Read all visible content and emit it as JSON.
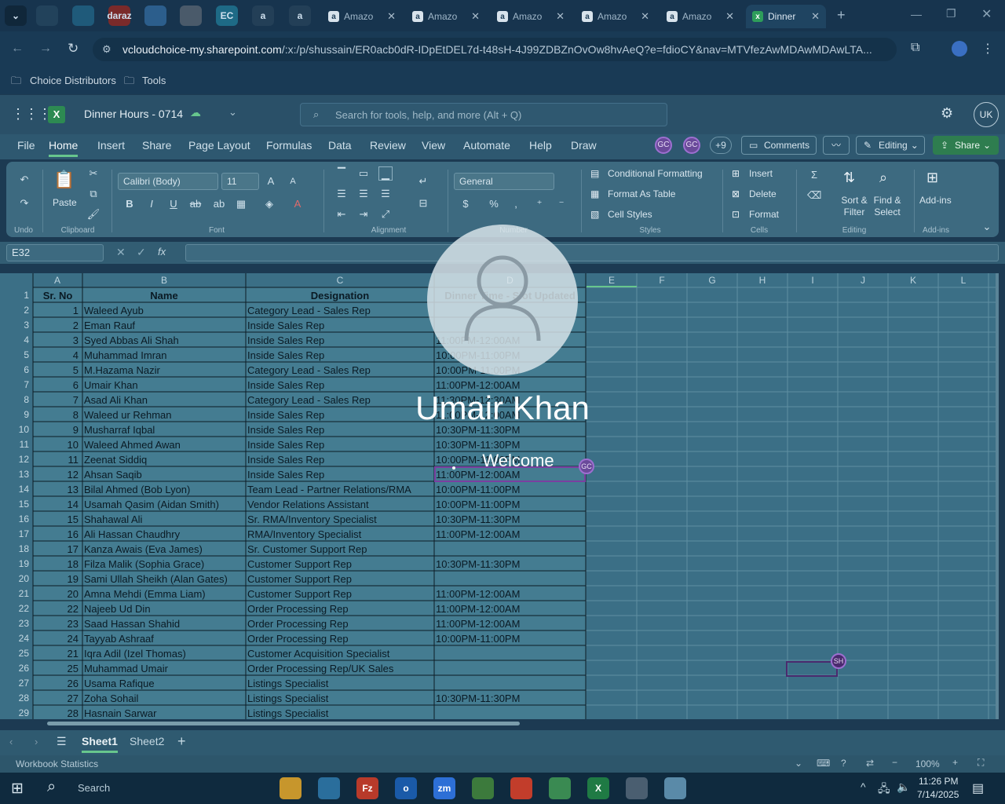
{
  "browser": {
    "pinned_icons": [
      "ring-icon",
      "edge-app-icon",
      "daraz-icon",
      "g-app-icon",
      "puzzle-app-icon",
      "ec-icon",
      "amazon-icon",
      "amazon-icon"
    ],
    "pinned_texts": [
      "",
      "",
      "daraz",
      "",
      "",
      "EC",
      "a",
      "a"
    ],
    "tabs": [
      {
        "label": "Amazo",
        "close": "✕"
      },
      {
        "label": "Amazo",
        "close": "✕"
      },
      {
        "label": "Amazo",
        "close": "✕"
      },
      {
        "label": "Amazo",
        "close": "✕"
      },
      {
        "label": "Amazo",
        "close": "✕"
      }
    ],
    "active_tab": {
      "label": "Dinner",
      "close": "✕"
    },
    "new_tab": "+",
    "url_domain": "vcloudchoice-my.sharepoint.com",
    "url_path": "/:x:/p/shussain/ER0acb0dR-IDpEtDEL7d-t48sH-4J99ZDBZnOvOw8hvAeQ?e=fdioCY&nav=MTVfezAwMDAwMDAwLTA...",
    "bookmarks": [
      "Choice Distributors",
      "Tools"
    ]
  },
  "excel": {
    "doc_title": "Dinner Hours - 0714",
    "search_placeholder": "Search for tools, help, and more (Alt + Q)",
    "user_initials": "UK",
    "ribbon_tabs": [
      "File",
      "Home",
      "Insert",
      "Share",
      "Page Layout",
      "Formulas",
      "Data",
      "Review",
      "View",
      "Automate",
      "Help",
      "Draw"
    ],
    "collab": {
      "a": "GC",
      "b": "GC",
      "more": "+9"
    },
    "comments_label": "Comments",
    "editing_label": "Editing",
    "share_label": "Share",
    "ribbon": {
      "undo": "Undo",
      "paste": "Paste",
      "clipboard": "Clipboard",
      "font_name": "Calibri (Body)",
      "font_size": "11",
      "font": "Font",
      "alignment": "Alignment",
      "number_format": "General",
      "number": "Number",
      "cond_format": "Conditional Formatting",
      "format_table": "Format As Table",
      "cell_styles": "Cell Styles",
      "styles": "Styles",
      "insert": "Insert",
      "delete": "Delete",
      "format": "Format",
      "cells": "Cells",
      "sort_filter": "Sort & Filter",
      "find_select": "Find & Select",
      "editing": "Editing",
      "addins": "Add-ins",
      "addins_grp": "Add-ins"
    },
    "name_box": "E32",
    "fx": "fx",
    "columns": [
      "A",
      "B",
      "C",
      "D",
      "E",
      "F",
      "G",
      "H",
      "I",
      "J",
      "K",
      "L"
    ],
    "headers": {
      "a": "Sr. No",
      "b": "Name",
      "c": "Designation",
      "d": "Dinner Time - Slot Updated"
    },
    "rows": [
      {
        "r": "2",
        "a": "1",
        "b": "Waleed Ayub",
        "c": "Category Lead - Sales Rep",
        "d": ""
      },
      {
        "r": "3",
        "a": "2",
        "b": "Eman Rauf",
        "c": "Inside Sales Rep",
        "d": ""
      },
      {
        "r": "4",
        "a": "3",
        "b": "Syed Abbas Ali Shah",
        "c": "Inside Sales Rep",
        "d": "11:00PM-12:00AM"
      },
      {
        "r": "5",
        "a": "4",
        "b": "Muhammad Imran",
        "c": "Inside Sales Rep",
        "d": "10:00PM-11:00PM"
      },
      {
        "r": "6",
        "a": "5",
        "b": "M.Hazama Nazir",
        "c": "Category Lead - Sales Rep",
        "d": "10:00PM-11:00PM"
      },
      {
        "r": "7",
        "a": "6",
        "b": "Umair Khan",
        "c": "Inside Sales Rep",
        "d": "11:00PM-12:00AM"
      },
      {
        "r": "8",
        "a": "7",
        "b": "Asad Ali Khan",
        "c": "Category Lead - Sales Rep",
        "d": "11:30PM-12:30AM"
      },
      {
        "r": "9",
        "a": "8",
        "b": "Waleed ur Rehman",
        "c": "Inside Sales Rep",
        "d": "11:00PM-12:00AM"
      },
      {
        "r": "10",
        "a": "9",
        "b": "Musharraf Iqbal",
        "c": "Inside Sales Rep",
        "d": "10:30PM-11:30PM"
      },
      {
        "r": "11",
        "a": "10",
        "b": "Waleed Ahmed Awan",
        "c": "Inside Sales Rep",
        "d": "10:30PM-11:30PM"
      },
      {
        "r": "12",
        "a": "11",
        "b": "Zeenat Siddiq",
        "c": "Inside Sales Rep",
        "d": "10:00PM-11:00PM"
      },
      {
        "r": "13",
        "a": "12",
        "b": "Ahsan Saqib",
        "c": "Inside Sales Rep",
        "d": "11:00PM-12:00AM"
      },
      {
        "r": "14",
        "a": "13",
        "b": "Bilal Ahmed (Bob Lyon)",
        "c": "Team Lead - Partner Relations/RMA",
        "d": "10:00PM-11:00PM"
      },
      {
        "r": "15",
        "a": "14",
        "b": "Usamah Qasim (Aidan Smith)",
        "c": "Vendor Relations Assistant",
        "d": "10:00PM-11:00PM"
      },
      {
        "r": "16",
        "a": "15",
        "b": "Shahawal Ali",
        "c": "Sr. RMA/Inventory Specialist",
        "d": "10:30PM-11:30PM"
      },
      {
        "r": "17",
        "a": "16",
        "b": "Ali Hassan Chaudhry",
        "c": "RMA/Inventory Specialist",
        "d": "11:00PM-12:00AM"
      },
      {
        "r": "18",
        "a": "17",
        "b": "Kanza Awais (Eva James)",
        "c": "Sr. Customer Support Rep",
        "d": ""
      },
      {
        "r": "19",
        "a": "18",
        "b": "Filza Malik (Sophia Grace)",
        "c": "Customer Support Rep",
        "d": "10:30PM-11:30PM"
      },
      {
        "r": "20",
        "a": "19",
        "b": "Sami Ullah Sheikh (Alan Gates)",
        "c": "Customer Support Rep",
        "d": ""
      },
      {
        "r": "21",
        "a": "20",
        "b": "Amna Mehdi (Emma Liam)",
        "c": "Customer Support Rep",
        "d": "11:00PM-12:00AM"
      },
      {
        "r": "22",
        "a": "22",
        "b": "Najeeb Ud Din",
        "c": "Order Processing Rep",
        "d": "11:00PM-12:00AM"
      },
      {
        "r": "23",
        "a": "23",
        "b": "Saad Hassan Shahid",
        "c": "Order Processing Rep",
        "d": "11:00PM-12:00AM"
      },
      {
        "r": "24",
        "a": "24",
        "b": "Tayyab Ashraaf",
        "c": "Order Processing Rep",
        "d": "10:00PM-11:00PM"
      },
      {
        "r": "25",
        "a": "21",
        "b": "Iqra Adil (Izel Thomas)",
        "c": "Customer Acquisition Specialist",
        "d": ""
      },
      {
        "r": "26",
        "a": "25",
        "b": "Muhammad Umair",
        "c": "Order Processing Rep/UK Sales",
        "d": ""
      },
      {
        "r": "27",
        "a": "26",
        "b": "Usama Rafique",
        "c": "Listings Specialist",
        "d": ""
      },
      {
        "r": "28",
        "a": "27",
        "b": "Zoha Sohail",
        "c": "Listings Specialist",
        "d": "10:30PM-11:30PM"
      },
      {
        "r": "29",
        "a": "28",
        "b": "Hasnain Sarwar",
        "c": "Listings Specialist",
        "d": ""
      }
    ],
    "header_row_num": "1",
    "cursor_badges": {
      "gc": "GC",
      "sh": "SH"
    },
    "sheets": [
      "Sheet1",
      "Sheet2"
    ],
    "add_sheet": "+",
    "status_left": "Workbook Statistics",
    "zoom": "100%"
  },
  "lock": {
    "user": "Umair Khan",
    "welcome": "Welcome"
  },
  "taskbar": {
    "search": "Search",
    "time": "11:26 PM",
    "date": "7/14/2025",
    "apps": [
      "file-explorer-icon",
      "app-icon",
      "filezilla-icon",
      "outlook-icon",
      "zoom-icon",
      "chrome-icon",
      "chrome-icon",
      "chrome-icon",
      "excel-icon",
      "calculator-icon",
      "notes-icon"
    ],
    "app_texts": [
      "",
      "",
      "Fz",
      "o",
      "zm",
      "",
      "",
      "",
      "X",
      "",
      ""
    ]
  },
  "colors": {
    "accent": "#67c68d",
    "share": "#2e7d4f",
    "selection": "#7a3fa0"
  }
}
